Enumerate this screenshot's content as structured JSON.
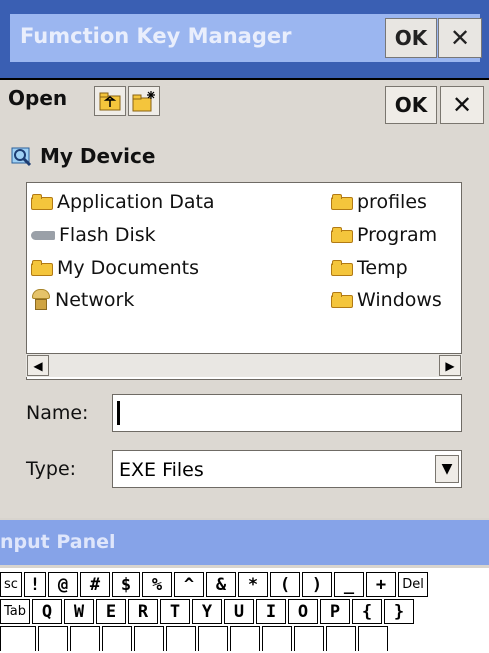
{
  "background_window": {
    "title": "Fumction Key Manager",
    "ok_label": "OK",
    "close_label": "✕"
  },
  "dialog": {
    "title": "Open",
    "ok_label": "OK",
    "close_label": "✕",
    "location": "My Device",
    "items": [
      {
        "label": "Application Data",
        "icon": "folder-icon"
      },
      {
        "label": "Flash Disk",
        "icon": "disk-icon"
      },
      {
        "label": "My Documents",
        "icon": "folder-icon"
      },
      {
        "label": "Network",
        "icon": "network-icon"
      },
      {
        "label": "profiles",
        "icon": "folder-icon"
      },
      {
        "label": "Program",
        "icon": "folder-icon"
      },
      {
        "label": "Temp",
        "icon": "folder-icon"
      },
      {
        "label": "Windows",
        "icon": "folder-icon"
      }
    ],
    "name_label": "Name:",
    "name_value": "",
    "type_label": "Type:",
    "type_value": "EXE Files"
  },
  "input_panel": {
    "title": "nput Panel",
    "row1": [
      "sc",
      "!",
      "@",
      "#",
      "$",
      "%",
      "^",
      "&",
      "*",
      "(",
      ")",
      "_",
      "+",
      "Del"
    ],
    "row2": [
      "Tab",
      "Q",
      "W",
      "E",
      "R",
      "T",
      "Y",
      "U",
      "I",
      "O",
      "P",
      "{",
      "}"
    ]
  },
  "colors": {
    "title_bar": "#3a5fb3",
    "input_panel_bar": "#86a3e8",
    "folder": "#f4c53c"
  }
}
